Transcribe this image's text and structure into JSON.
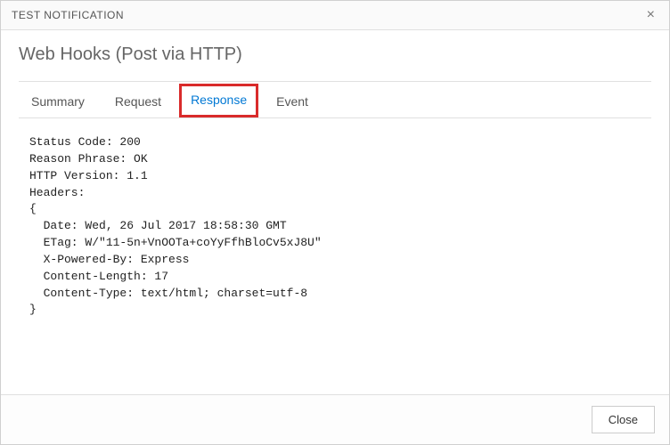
{
  "titlebar": {
    "title": "TEST NOTIFICATION",
    "close_glyph": "×"
  },
  "header": {
    "subtitle": "Web Hooks (Post via HTTP)"
  },
  "tabs": {
    "summary": "Summary",
    "request": "Request",
    "response": "Response",
    "event": "Event",
    "active": "response"
  },
  "response_body": "Status Code: 200\nReason Phrase: OK\nHTTP Version: 1.1\nHeaders:\n{\n  Date: Wed, 26 Jul 2017 18:58:30 GMT\n  ETag: W/\"11-5n+VnOOTa+coYyFfhBloCv5xJ8U\"\n  X-Powered-By: Express\n  Content-Length: 17\n  Content-Type: text/html; charset=utf-8\n}",
  "footer": {
    "close_label": "Close"
  }
}
